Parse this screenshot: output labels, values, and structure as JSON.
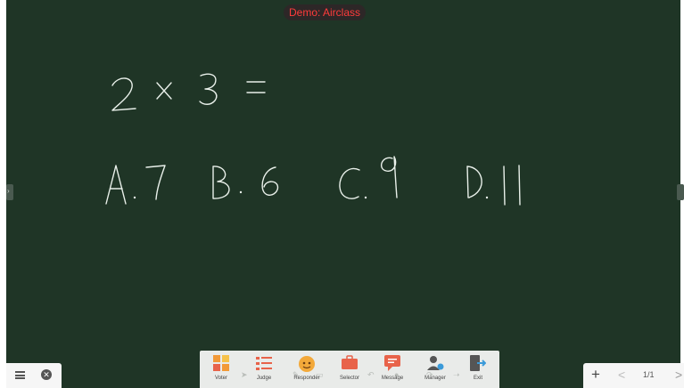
{
  "window": {
    "title": "Demo: Airclass"
  },
  "board": {
    "ink_text": [
      "2 X 3 =",
      "A.7",
      "B.6",
      "C.9",
      "D.11"
    ]
  },
  "toolbar": {
    "tools": [
      {
        "label": "Voter",
        "icon": "voter-icon"
      },
      {
        "label": "Judge",
        "icon": "judge-icon"
      },
      {
        "label": "Responder",
        "icon": "responder-icon"
      },
      {
        "label": "Selector",
        "icon": "selector-icon"
      },
      {
        "label": "Message",
        "icon": "message-icon"
      },
      {
        "label": "Manager",
        "icon": "manager-icon"
      },
      {
        "label": "Exit",
        "icon": "exit-icon"
      }
    ]
  },
  "left_controls": {
    "menu": "menu-icon",
    "close": "close-icon",
    "close_glyph": "✕"
  },
  "right_controls": {
    "add": "+",
    "prev": "<",
    "page": "1/1",
    "next": ">"
  },
  "colors": {
    "board": "#1f3526",
    "title_text": "#ff3b3b",
    "ink": "#e9f0ea"
  }
}
